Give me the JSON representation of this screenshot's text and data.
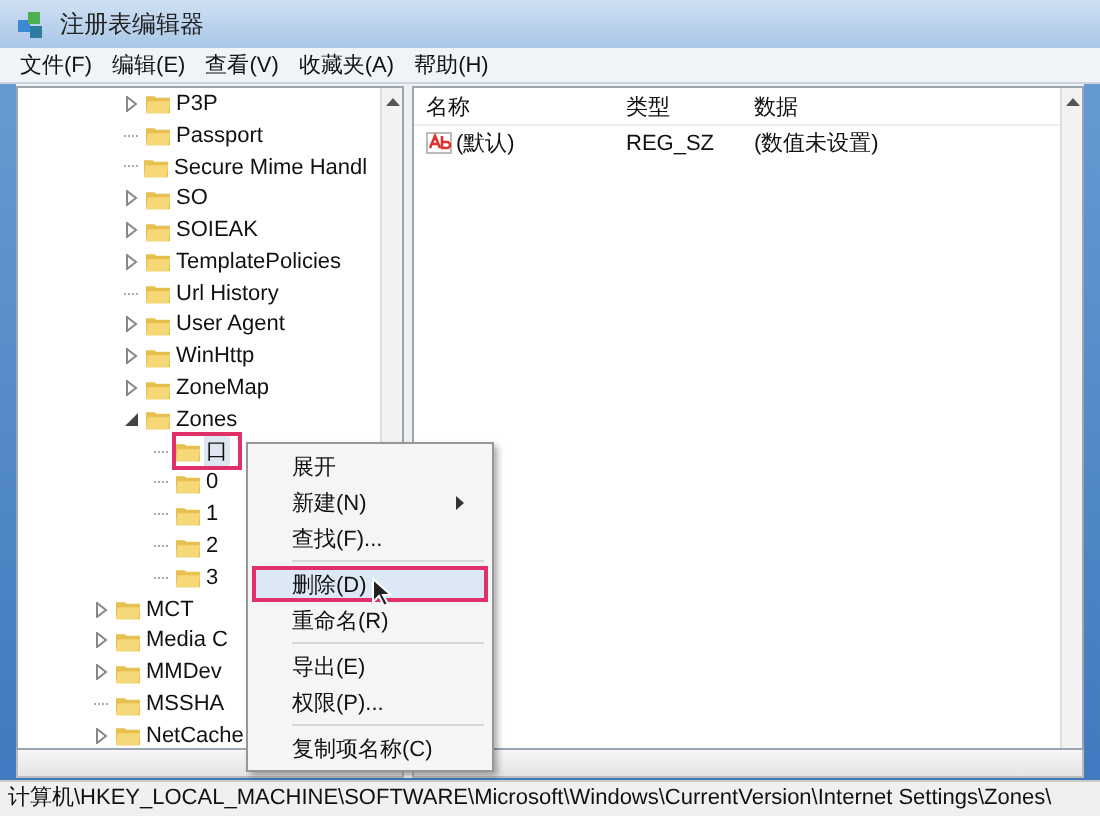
{
  "window": {
    "title": "注册表编辑器"
  },
  "menu_bar": [
    "文件(F)",
    "编辑(E)",
    "查看(V)",
    "收藏夹(A)",
    "帮助(H)"
  ],
  "tree": {
    "upper_items": [
      {
        "label": "P3P",
        "expandable": true,
        "expanded": false,
        "selected": false,
        "highlighted": false
      },
      {
        "label": "Passport",
        "expandable": false,
        "selected": false,
        "highlighted": false
      },
      {
        "label": "Secure Mime Handl",
        "expandable": false,
        "selected": false,
        "highlighted": false
      },
      {
        "label": "SO",
        "expandable": true,
        "expanded": false,
        "selected": false,
        "highlighted": false
      },
      {
        "label": "SOIEAK",
        "expandable": true,
        "expanded": false,
        "selected": false,
        "highlighted": false
      },
      {
        "label": "TemplatePolicies",
        "expandable": true,
        "expanded": false,
        "selected": false,
        "highlighted": false
      },
      {
        "label": "Url History",
        "expandable": false,
        "selected": false,
        "highlighted": false
      },
      {
        "label": "User Agent",
        "expandable": true,
        "expanded": false,
        "selected": false,
        "highlighted": false
      },
      {
        "label": "WinHttp",
        "expandable": true,
        "expanded": false,
        "selected": false,
        "highlighted": false
      },
      {
        "label": "ZoneMap",
        "expandable": true,
        "expanded": false,
        "selected": false,
        "highlighted": false
      },
      {
        "label": "Zones",
        "expandable": true,
        "expanded": true,
        "selected": false,
        "highlighted": false,
        "children": [
          {
            "label": "口",
            "expandable": false,
            "selected": true,
            "highlighted": true
          },
          {
            "label": "0",
            "expandable": false,
            "selected": false,
            "highlighted": false
          },
          {
            "label": "1",
            "expandable": false,
            "selected": false,
            "highlighted": false
          },
          {
            "label": "2",
            "expandable": false,
            "selected": false,
            "highlighted": false
          },
          {
            "label": "3",
            "expandable": false,
            "selected": false,
            "highlighted": false
          }
        ]
      }
    ],
    "lower_items": [
      {
        "label": "MCT",
        "expandable": true,
        "expanded": false,
        "selected": false,
        "highlighted": false
      },
      {
        "label": "Media C",
        "expandable": true,
        "expanded": false,
        "selected": false,
        "highlighted": false
      },
      {
        "label": "MMDev",
        "expandable": true,
        "expanded": false,
        "selected": false,
        "highlighted": false
      },
      {
        "label": "MSSHA",
        "expandable": false,
        "selected": false,
        "highlighted": false
      },
      {
        "label": "NetCache",
        "expandable": true,
        "expanded": false,
        "selected": false,
        "highlighted": false
      }
    ]
  },
  "values": {
    "columns": [
      "名称",
      "类型",
      "数据"
    ],
    "rows": [
      {
        "name": "(默认)",
        "type": "REG_SZ",
        "data": "(数值未设置)"
      }
    ]
  },
  "context_menu": [
    {
      "kind": "item",
      "label": "展开",
      "submenu": false,
      "hovered": false,
      "highlighted": false
    },
    {
      "kind": "item",
      "label": "新建(N)",
      "submenu": true,
      "hovered": false,
      "highlighted": false
    },
    {
      "kind": "item",
      "label": "查找(F)...",
      "submenu": false,
      "hovered": false,
      "highlighted": false
    },
    {
      "kind": "separator"
    },
    {
      "kind": "item",
      "label": "删除(D)",
      "submenu": false,
      "hovered": true,
      "highlighted": true
    },
    {
      "kind": "item",
      "label": "重命名(R)",
      "submenu": false,
      "hovered": false,
      "highlighted": false
    },
    {
      "kind": "separator"
    },
    {
      "kind": "item",
      "label": "导出(E)",
      "submenu": false,
      "hovered": false,
      "highlighted": false
    },
    {
      "kind": "item",
      "label": "权限(P)...",
      "submenu": false,
      "hovered": false,
      "highlighted": false
    },
    {
      "kind": "separator"
    },
    {
      "kind": "item",
      "label": "复制项名称(C)",
      "submenu": false,
      "hovered": false,
      "highlighted": false
    }
  ],
  "status_bar": "计算机\\HKEY_LOCAL_MACHINE\\SOFTWARE\\Microsoft\\Windows\\CurrentVersion\\Internet Settings\\Zones\\"
}
